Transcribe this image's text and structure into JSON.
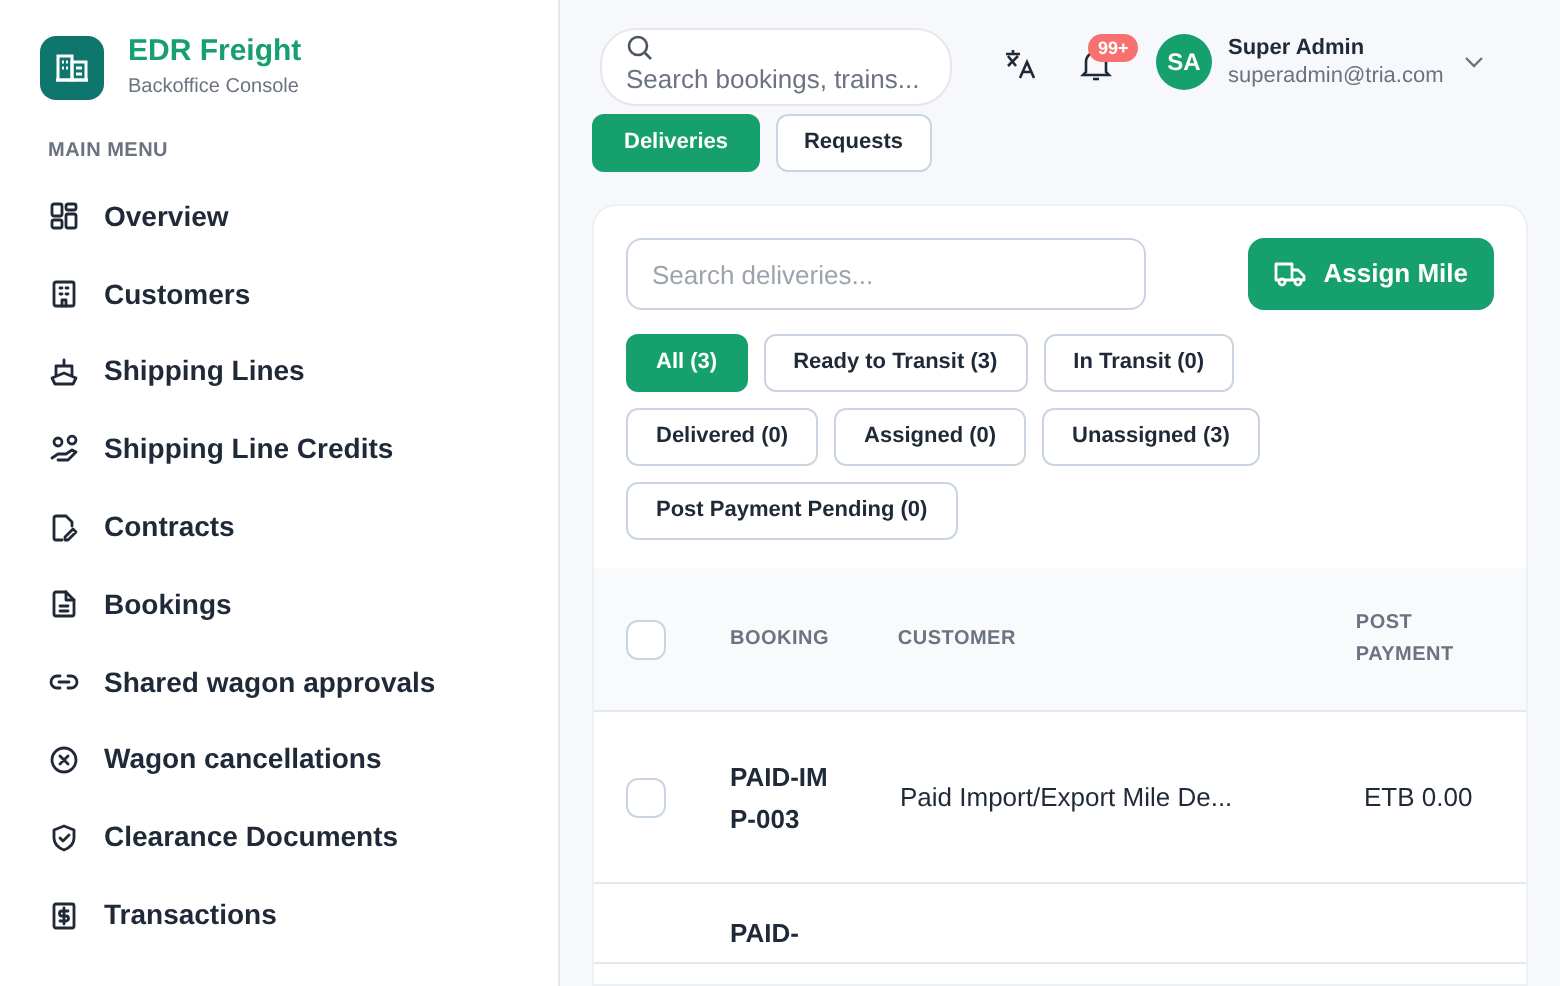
{
  "brand": {
    "name": "EDR Freight",
    "subtitle": "Backoffice Console"
  },
  "menu_heading": "MAIN MENU",
  "menu": [
    {
      "label": "Overview"
    },
    {
      "label": "Customers"
    },
    {
      "label": "Shipping Lines"
    },
    {
      "label": "Shipping Line Credits"
    },
    {
      "label": "Contracts"
    },
    {
      "label": "Bookings"
    },
    {
      "label": "Shared wagon approvals"
    },
    {
      "label": "Wagon cancellations"
    },
    {
      "label": "Clearance Documents"
    },
    {
      "label": "Transactions"
    }
  ],
  "topbar": {
    "search": {
      "placeholder": "Search bookings, trains..."
    },
    "notification_count": "99+",
    "user": {
      "initials": "SA",
      "name": "Super Admin",
      "email": "superadmin@tria.com"
    }
  },
  "tabs": [
    {
      "label": "Deliveries",
      "selected": true
    },
    {
      "label": "Requests",
      "selected": false
    }
  ],
  "delivery_search": {
    "placeholder": "Search deliveries..."
  },
  "assign_button": "Assign Mile",
  "filters": [
    {
      "label": "All (3)",
      "selected": true
    },
    {
      "label": "Ready to Transit (3)",
      "selected": false
    },
    {
      "label": "In Transit (0)",
      "selected": false
    },
    {
      "label": "Delivered (0)",
      "selected": false
    },
    {
      "label": "Assigned (0)",
      "selected": false
    },
    {
      "label": "Unassigned (3)",
      "selected": false
    },
    {
      "label": "Post Payment Pending (0)",
      "selected": false
    }
  ],
  "table": {
    "select_all_checked": false,
    "columns": [
      "BOOKING",
      "CUSTOMER",
      "POST PAYMENT"
    ],
    "rows": [
      {
        "checked": false,
        "booking": "PAID-IMP-003",
        "customer": "Paid Import/Export Mile De...",
        "post_payment": "ETB 0.00"
      },
      {
        "booking": "PAID-"
      }
    ]
  }
}
